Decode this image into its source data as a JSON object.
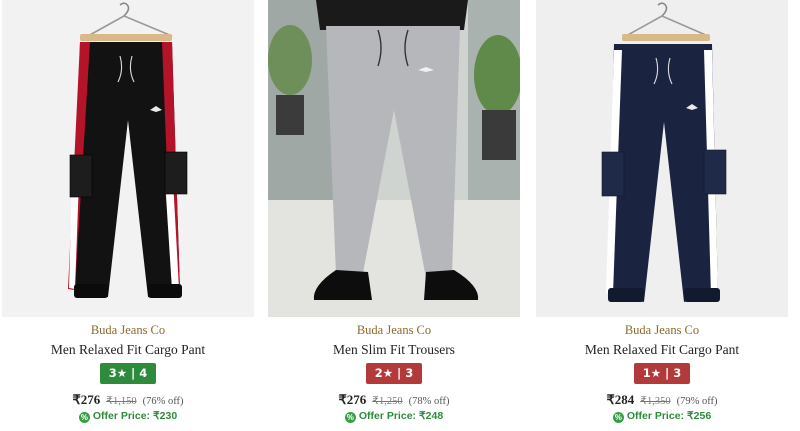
{
  "products": [
    {
      "brand": "Buda Jeans Co",
      "title": "Men Relaxed Fit Cargo Pant",
      "rating": "3★ | 4",
      "rating_color": "#2e8b3c",
      "price": "₹276",
      "mrp": "₹1,150",
      "discount": "(76% off)",
      "offer_label": "Offer Price:",
      "offer_price": "₹230",
      "image_icon": "black-cargo-jogger-image"
    },
    {
      "brand": "Buda Jeans Co",
      "title": "Men Slim Fit Trousers",
      "rating": "2★ | 3",
      "rating_color": "#b23a3a",
      "price": "₹276",
      "mrp": "₹1,250",
      "discount": "(78% off)",
      "offer_label": "Offer Price:",
      "offer_price": "₹248",
      "image_icon": "grey-trousers-model-image"
    },
    {
      "brand": "Buda Jeans Co",
      "title": "Men Relaxed Fit Cargo Pant",
      "rating": "1★ | 3",
      "rating_color": "#b23a3a",
      "price": "₹284",
      "mrp": "₹1,350",
      "discount": "(79% off)",
      "offer_label": "Offer Price:",
      "offer_price": "₹256",
      "image_icon": "navy-cargo-jogger-image"
    }
  ],
  "colors": {
    "brand_text": "#8a6a2c",
    "offer_green": "#2e8b3c"
  }
}
